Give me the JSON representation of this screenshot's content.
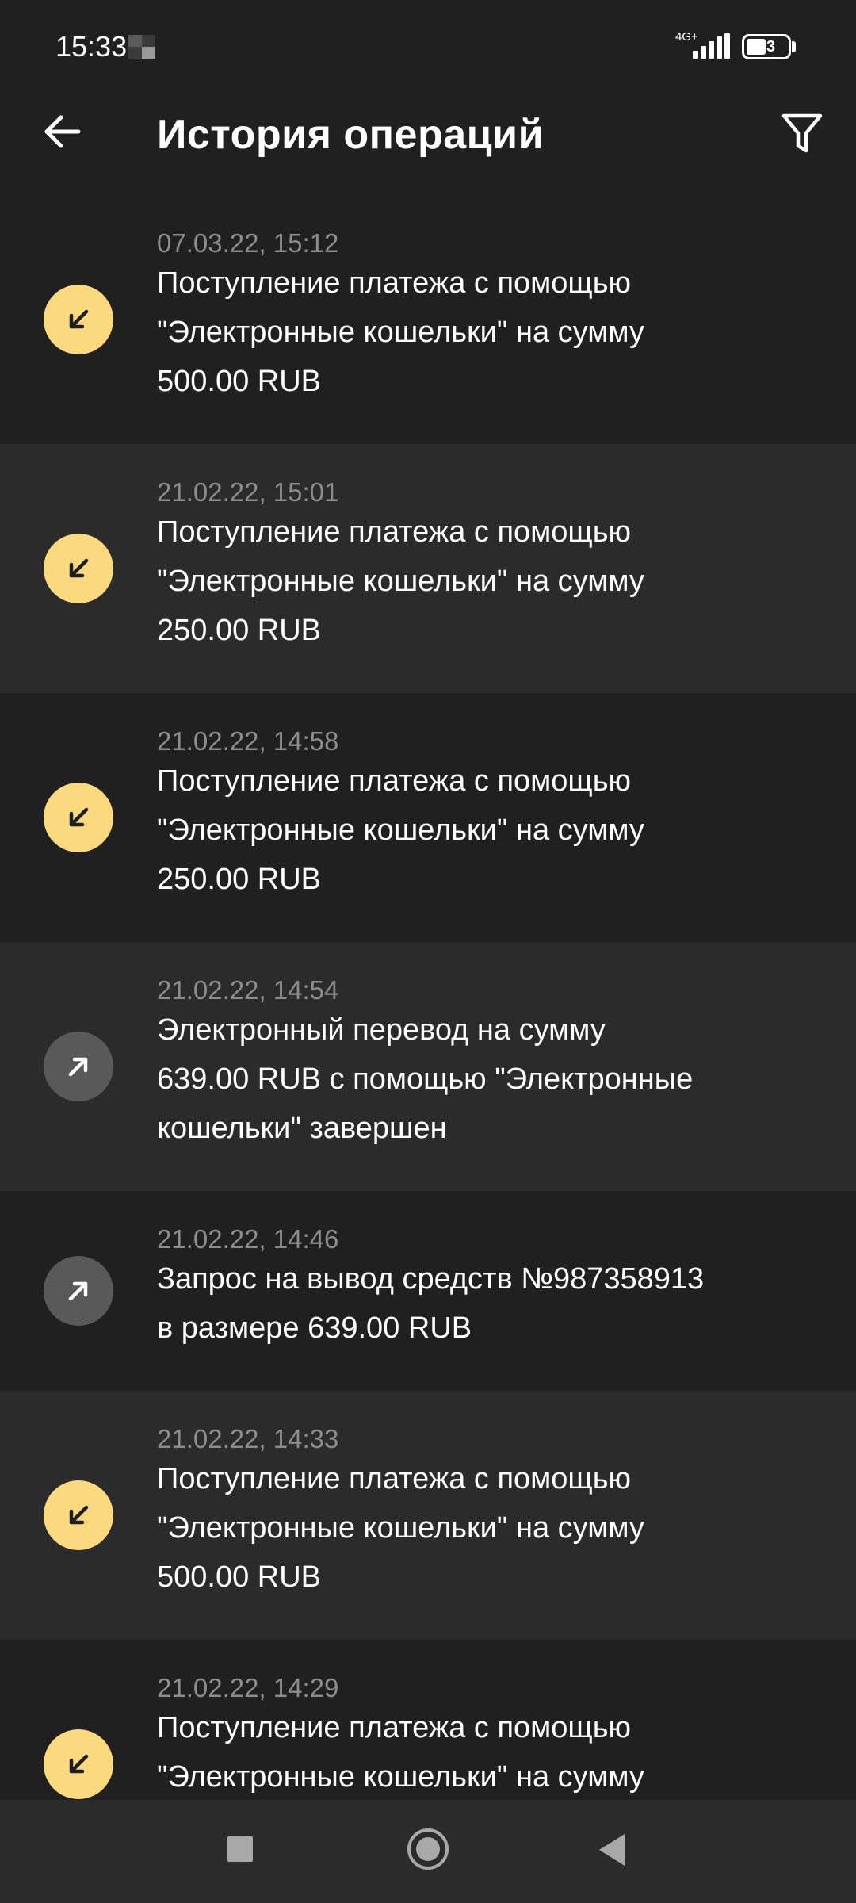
{
  "status_bar": {
    "time": "15:33",
    "network": "4G+",
    "battery": "43"
  },
  "header": {
    "title": "История операций",
    "back_icon": "arrow-left-icon",
    "filter_icon": "filter-funnel-icon"
  },
  "transactions": [
    {
      "date": "07.03.22, 15:12",
      "lines": [
        "Поступление платежа с помощью",
        "\"Электронные кошельки\" на сумму",
        "500.00 RUB"
      ],
      "direction": "incoming",
      "icon": "arrow-down-left-icon"
    },
    {
      "date": "21.02.22, 15:01",
      "lines": [
        "Поступление платежа с помощью",
        "\"Электронные кошельки\" на сумму",
        "250.00 RUB"
      ],
      "direction": "incoming",
      "icon": "arrow-down-left-icon"
    },
    {
      "date": "21.02.22, 14:58",
      "lines": [
        "Поступление платежа с помощью",
        "\"Электронные кошельки\" на сумму",
        "250.00 RUB"
      ],
      "direction": "incoming",
      "icon": "arrow-down-left-icon"
    },
    {
      "date": "21.02.22, 14:54",
      "lines": [
        "Электронный перевод на сумму",
        "639.00 RUB с помощью \"Электронные",
        "кошельки\" завершен"
      ],
      "direction": "outgoing",
      "icon": "arrow-up-right-icon"
    },
    {
      "date": "21.02.22, 14:46",
      "lines": [
        "Запрос на вывод средств №987358913",
        "в размере 639.00 RUB"
      ],
      "direction": "outgoing",
      "icon": "arrow-up-right-icon"
    },
    {
      "date": "21.02.22, 14:33",
      "lines": [
        "Поступление платежа с помощью",
        "\"Электронные кошельки\" на сумму",
        "500.00 RUB"
      ],
      "direction": "incoming",
      "icon": "arrow-down-left-icon"
    },
    {
      "date": "21.02.22, 14:29",
      "lines": [
        "Поступление платежа с помощью",
        "\"Электронные кошельки\" на сумму"
      ],
      "direction": "incoming",
      "icon": "arrow-down-left-icon"
    }
  ],
  "colors": {
    "incoming_icon_bg": "#fbd97f",
    "outgoing_icon_bg": "#595959",
    "row_dark": "#202020",
    "row_light": "#2b2b2b"
  },
  "nav": {
    "recents_icon": "square-icon",
    "home_icon": "circle-icon",
    "back_icon": "triangle-back-icon"
  }
}
